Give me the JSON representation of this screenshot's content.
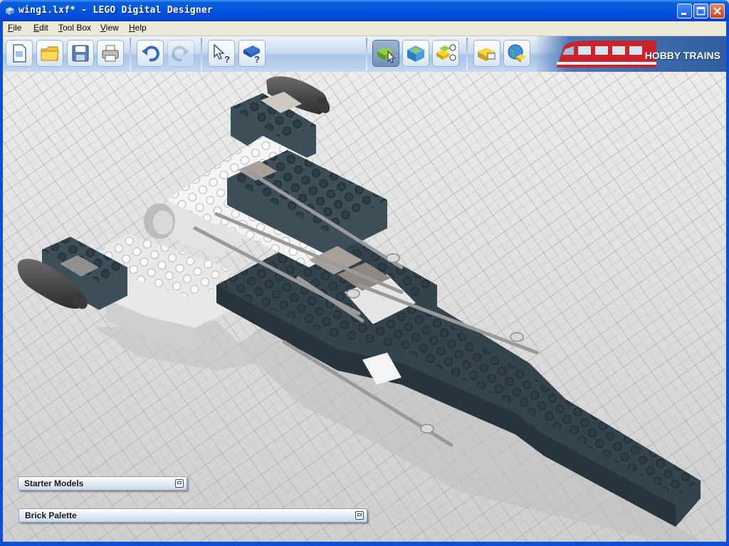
{
  "window": {
    "title": "wing1.lxf* - LEGO Digital Designer",
    "controls": [
      "minimize",
      "maximize",
      "close"
    ]
  },
  "menu": {
    "items": [
      {
        "label": "File",
        "access_key": "F"
      },
      {
        "label": "Edit",
        "access_key": "E"
      },
      {
        "label": "Tool Box",
        "access_key": "T"
      },
      {
        "label": "View",
        "access_key": "V"
      },
      {
        "label": "Help",
        "access_key": "H"
      }
    ]
  },
  "toolbar": {
    "groups": [
      {
        "buttons": [
          {
            "icon": "new-file-icon"
          },
          {
            "icon": "open-folder-icon"
          },
          {
            "icon": "save-disk-icon"
          },
          {
            "icon": "print-icon"
          }
        ]
      },
      {
        "buttons": [
          {
            "icon": "undo-icon"
          },
          {
            "icon": "redo-icon",
            "disabled": true
          }
        ]
      },
      {
        "buttons": [
          {
            "icon": "pointer-help-icon"
          },
          {
            "icon": "guide-help-icon"
          }
        ]
      },
      {
        "buttons": [
          {
            "icon": "build-mode-icon",
            "active": true
          },
          {
            "icon": "view-mode-icon"
          },
          {
            "icon": "building-guide-mode-icon"
          }
        ]
      },
      {
        "buttons": [
          {
            "icon": "share-brick-icon"
          },
          {
            "icon": "online-globe-icon"
          }
        ]
      }
    ],
    "brand_banner": {
      "label": "HOBBY TRAINS",
      "image": "red-train"
    }
  },
  "panels": {
    "starter_models": {
      "title": "Starter Models",
      "state": "collapsed"
    },
    "brick_palette": {
      "title": "Brick Palette",
      "state": "collapsed"
    }
  },
  "colors": {
    "title_bar": "#0255e0",
    "toolbar": "#c9dbf0",
    "viewport_bg": "#dcdcdc",
    "brick_dark": "#3c4e58",
    "brick_white": "#f2f2f2",
    "brick_gray": "#9a9a9a"
  }
}
